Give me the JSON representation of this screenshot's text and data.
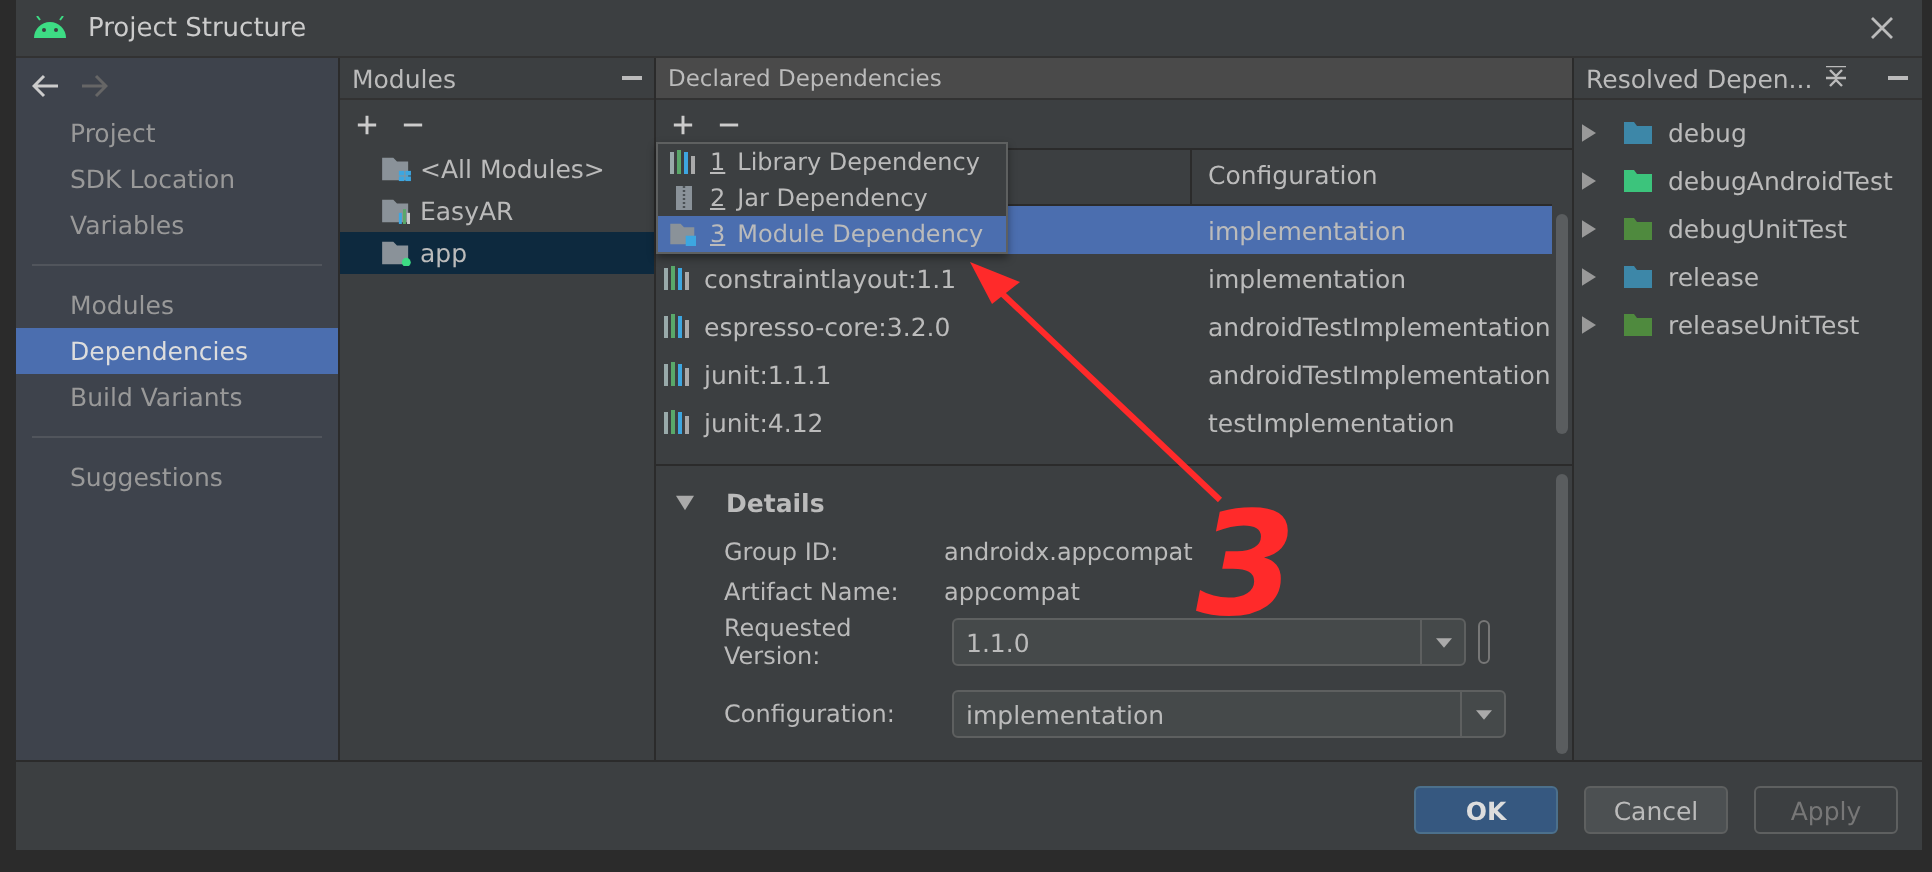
{
  "window": {
    "title": "Project Structure"
  },
  "nav": {
    "back_enabled": true,
    "forward_enabled": false
  },
  "sidebar": {
    "groups": [
      {
        "items": [
          {
            "label": "Project",
            "selected": false
          },
          {
            "label": "SDK Location",
            "selected": false
          },
          {
            "label": "Variables",
            "selected": false
          }
        ]
      },
      {
        "items": [
          {
            "label": "Modules",
            "selected": false
          },
          {
            "label": "Dependencies",
            "selected": true
          },
          {
            "label": "Build Variants",
            "selected": false
          }
        ]
      },
      {
        "items": [
          {
            "label": "Suggestions",
            "selected": false
          }
        ]
      }
    ]
  },
  "modules": {
    "title": "Modules",
    "items": [
      {
        "label": "<All Modules>",
        "kind": "all",
        "selected": false
      },
      {
        "label": "EasyAR",
        "kind": "library",
        "selected": false
      },
      {
        "label": "app",
        "kind": "app",
        "selected": true
      }
    ]
  },
  "declared": {
    "title": "Declared Dependencies",
    "columns": [
      "Configuration"
    ],
    "rows": [
      {
        "name": "",
        "configuration": "implementation",
        "selected": true
      },
      {
        "name": "constraintlayout:1.1",
        "configuration": "implementation",
        "selected": false
      },
      {
        "name": "espresso-core:3.2.0",
        "configuration": "androidTestImplementation",
        "selected": false
      },
      {
        "name": "junit:1.1.1",
        "configuration": "androidTestImplementation",
        "selected": false
      },
      {
        "name": "junit:4.12",
        "configuration": "testImplementation",
        "selected": false
      }
    ],
    "add_menu": [
      {
        "number": "1",
        "label": "Library Dependency",
        "kind": "library",
        "selected": false
      },
      {
        "number": "2",
        "label": "Jar Dependency",
        "kind": "jar",
        "selected": false
      },
      {
        "number": "3",
        "label": "Module Dependency",
        "kind": "module",
        "selected": true
      }
    ],
    "details": {
      "title": "Details",
      "expanded": true,
      "group_id_label": "Group ID:",
      "group_id": "androidx.appcompat",
      "artifact_label": "Artifact Name:",
      "artifact": "appcompat",
      "version_label": "Requested Version:",
      "version": "1.1.0",
      "configuration_label": "Configuration:",
      "configuration": "implementation"
    }
  },
  "resolved": {
    "title": "Resolved Depen...",
    "items": [
      {
        "label": "debug",
        "color": "#3d87a8"
      },
      {
        "label": "debugAndroidTest",
        "color": "#3cc47c"
      },
      {
        "label": "debugUnitTest",
        "color": "#4f8a3e"
      },
      {
        "label": "release",
        "color": "#3d87a8"
      },
      {
        "label": "releaseUnitTest",
        "color": "#4f8a3e"
      }
    ]
  },
  "annotation": {
    "label": "3"
  },
  "buttons": [
    {
      "label": "OK",
      "kind": "primary",
      "disabled": false
    },
    {
      "label": "Cancel",
      "kind": "normal",
      "disabled": false
    },
    {
      "label": "Apply",
      "kind": "normal",
      "disabled": true
    }
  ]
}
